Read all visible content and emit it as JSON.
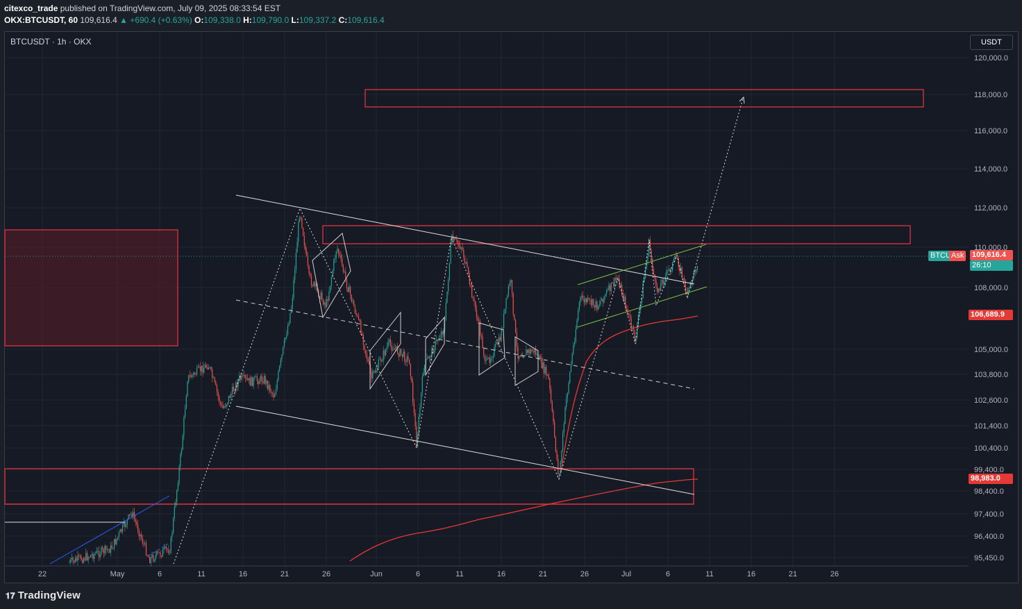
{
  "header": {
    "author": "citexco_trade",
    "published_text": "published on TradingView.com, July 09, 2025 08:33:54 EST",
    "symbol": "OKX:BTCUSDT, 60",
    "last": "109,616.4",
    "change": "▲ +690.4 (+0.63%)",
    "o_label": "O:",
    "o": "109,338.0",
    "h_label": "H:",
    "h": "109,790.0",
    "l_label": "L:",
    "l": "109,337.2",
    "c_label": "C:",
    "c": "109,616.4"
  },
  "pane": {
    "title": "BTCUSDT · 1h · OKX",
    "currency_button": "USDT"
  },
  "price_axis": {
    "labels": [
      "120,000.0",
      "118,000.0",
      "116,000.0",
      "114,000.0",
      "112,000.0",
      "110,000.0",
      "108,000.0",
      "105,000.0",
      "103,800.0",
      "102,600.0",
      "101,400.0",
      "100,400.0",
      "99,400.0",
      "98,400.0",
      "97,400.0",
      "96,400.0",
      "95,450.0"
    ]
  },
  "time_axis": {
    "labels": [
      "22",
      "May",
      "6",
      "11",
      "16",
      "21",
      "26",
      "Jun",
      "6",
      "11",
      "16",
      "21",
      "26",
      "Jul",
      "6",
      "11",
      "16",
      "21",
      "26"
    ]
  },
  "tags": {
    "symbol_short": "BTCU",
    "ask_label": "Ask",
    "last_price": "109,616.4",
    "countdown": "26:10",
    "ma_fast": "106,689.9",
    "ma_slow": "98,983.0"
  },
  "colors": {
    "up": "#26a69a",
    "down": "#ef5350",
    "box": "#c62f3c",
    "ma": "#e53935",
    "trend": "#ffffff",
    "channel": "#7cc442",
    "blue": "#2962ff"
  },
  "footer": {
    "brand": "TradingView"
  }
}
